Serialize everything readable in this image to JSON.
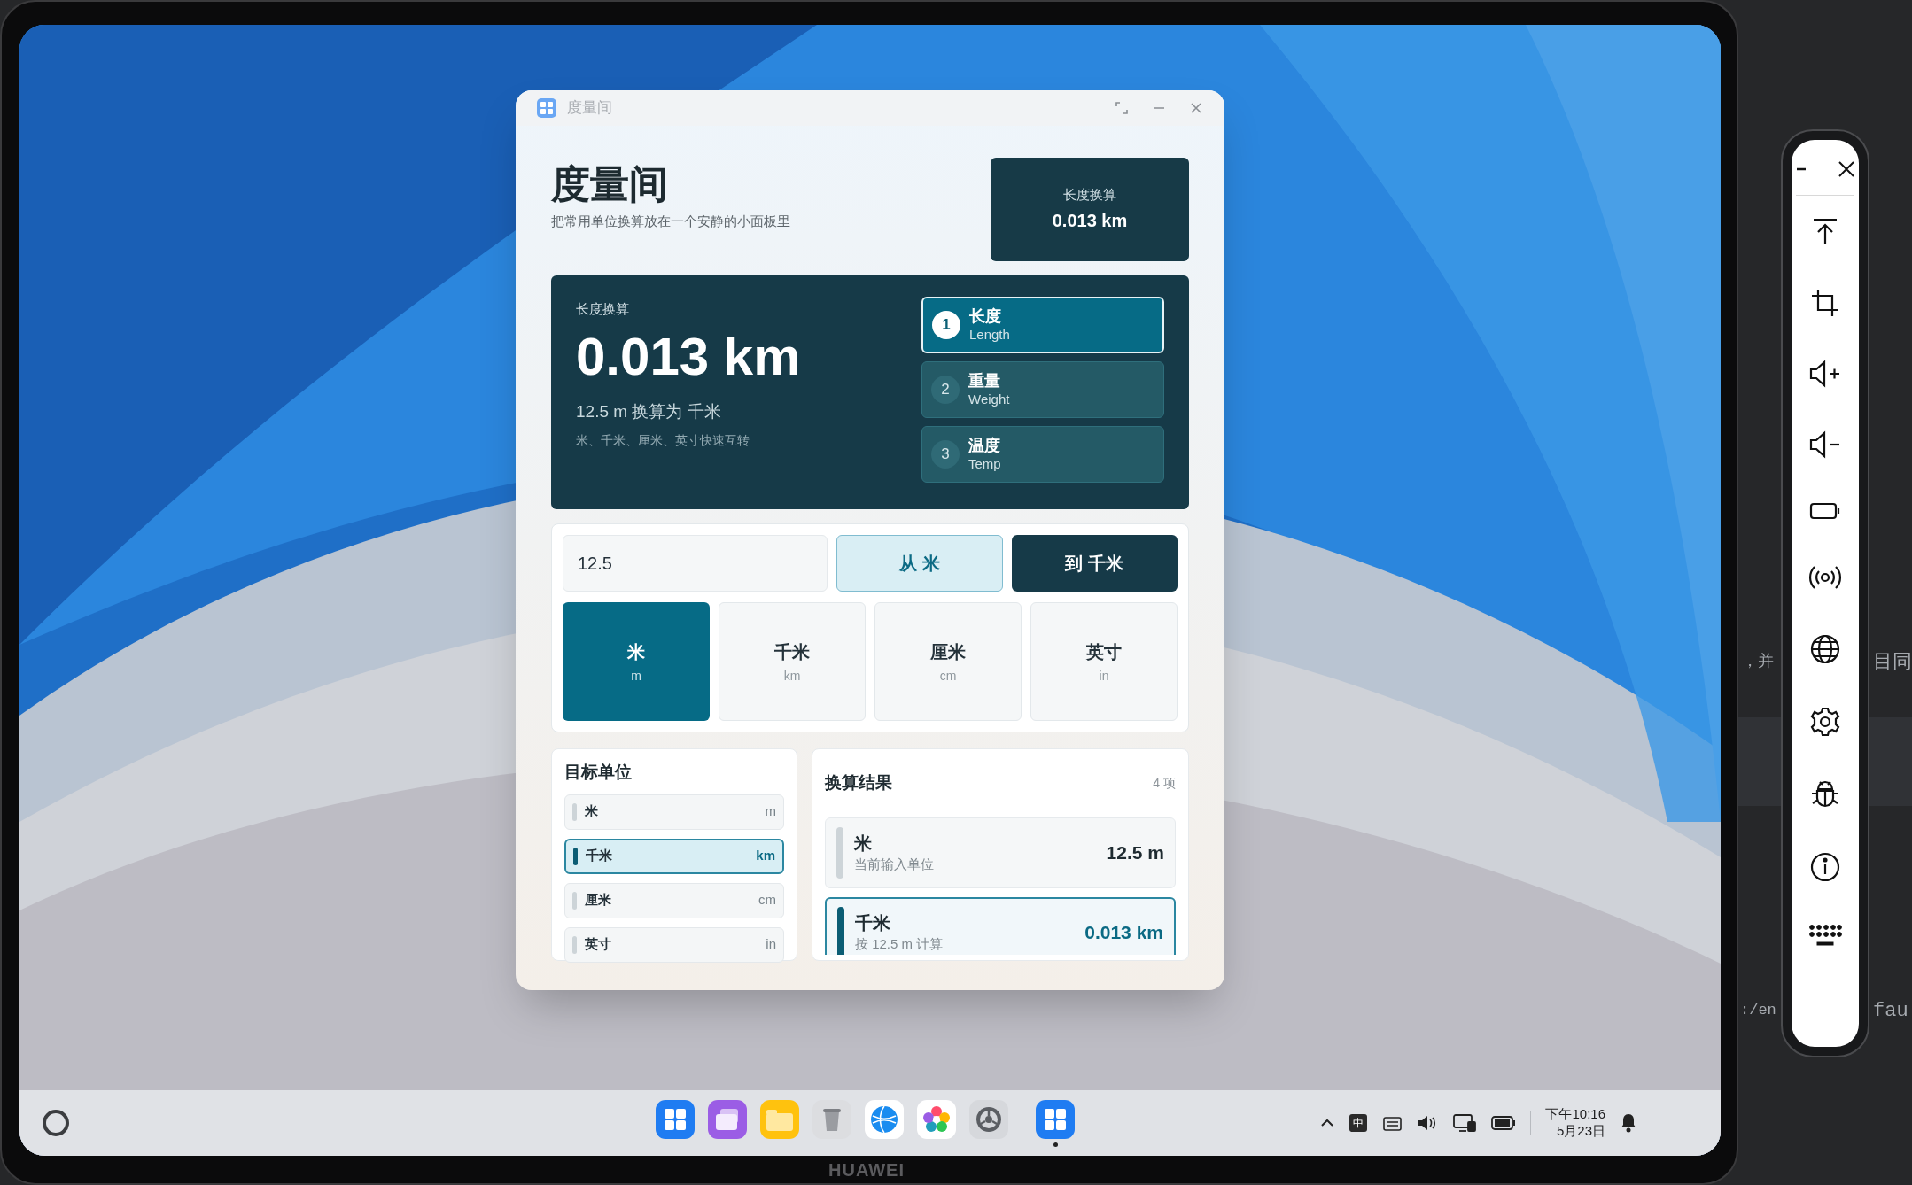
{
  "window": {
    "title": "度量间"
  },
  "header": {
    "title": "度量间",
    "subtitle": "把常用单位换算放在一个安静的小面板里"
  },
  "summary_card": {
    "label": "长度换算",
    "value": "0.013 km"
  },
  "hero": {
    "label": "长度换算",
    "value": "0.013 km",
    "description": "12.5 m 换算为 千米",
    "note": "米、千米、厘米、英寸快速互转"
  },
  "categories": [
    {
      "number": "1",
      "name": "长度",
      "english": "Length",
      "selected": true
    },
    {
      "number": "2",
      "name": "重量",
      "english": "Weight",
      "selected": false
    },
    {
      "number": "3",
      "name": "温度",
      "english": "Temp",
      "selected": false
    }
  ],
  "converter": {
    "value": "12.5",
    "from_button": "从 米",
    "to_button": "到 千米"
  },
  "units": [
    {
      "name": "米",
      "abbr": "m",
      "selected": true
    },
    {
      "name": "千米",
      "abbr": "km",
      "selected": false
    },
    {
      "name": "厘米",
      "abbr": "cm",
      "selected": false
    },
    {
      "name": "英寸",
      "abbr": "in",
      "selected": false
    }
  ],
  "target_units": {
    "title": "目标单位",
    "items": [
      {
        "name": "米",
        "abbr": "m",
        "selected": false
      },
      {
        "name": "千米",
        "abbr": "km",
        "selected": true
      },
      {
        "name": "厘米",
        "abbr": "cm",
        "selected": false
      },
      {
        "name": "英寸",
        "abbr": "in",
        "selected": false
      }
    ]
  },
  "results": {
    "title": "换算结果",
    "count": "4 项",
    "items": [
      {
        "name": "米",
        "note": "当前输入单位",
        "value": "12.5 m",
        "selected": false
      },
      {
        "name": "千米",
        "note": "按 12.5 m 计算",
        "value": "0.013 km",
        "selected": true
      }
    ]
  },
  "taskbar": {
    "apps": [
      {
        "kind": "grid",
        "running": false
      },
      {
        "kind": "windows",
        "running": false
      },
      {
        "kind": "folder",
        "running": false
      },
      {
        "kind": "trash",
        "running": false
      },
      {
        "kind": "browser",
        "running": false
      },
      {
        "kind": "photos",
        "running": false
      },
      {
        "kind": "settings",
        "running": false
      },
      {
        "kind": "grid",
        "running": true
      }
    ],
    "input_method": "中",
    "time": "下午10:16",
    "date": "5月23日"
  },
  "bezel_brand": "HUAWEI",
  "background_text": [
    "，并",
    "目同",
    ":/en",
    "fau"
  ]
}
